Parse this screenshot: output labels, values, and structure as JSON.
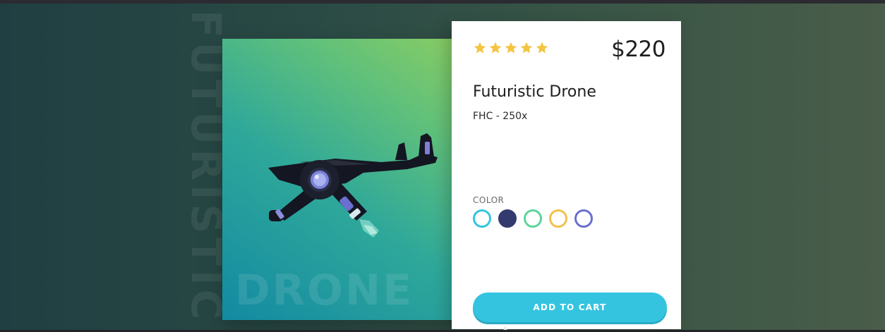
{
  "background_word": "FUTURISTIC",
  "image": {
    "overlay_word": "DRONE",
    "drone_icon": "drone-icon",
    "gradient_colors": [
      "#138aa2",
      "#5fc07b",
      "#8acd63"
    ]
  },
  "product": {
    "rating": 5,
    "rating_max": 5,
    "star_color": "#f4c542",
    "price": "$220",
    "title": "Futuristic Drone",
    "model": "FHC - 250x"
  },
  "color_section": {
    "label": "COLOR",
    "swatches": [
      {
        "name": "cyan",
        "color": "#35c4e0",
        "style": "outline"
      },
      {
        "name": "navy",
        "color": "#333a6e",
        "style": "filled"
      },
      {
        "name": "green",
        "color": "#5ed49a",
        "style": "outline"
      },
      {
        "name": "yellow",
        "color": "#f2c04e",
        "style": "outline"
      },
      {
        "name": "purple",
        "color": "#6a6fcf",
        "style": "outline"
      }
    ]
  },
  "cart": {
    "label": "ADD TO CART",
    "color": "#35c4e0"
  }
}
